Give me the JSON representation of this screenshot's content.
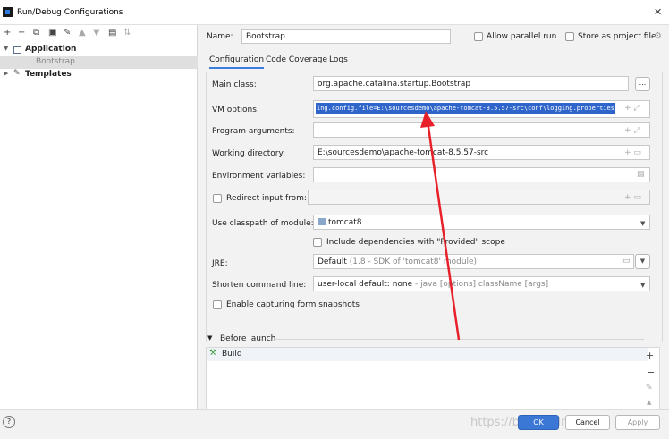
{
  "window": {
    "title": "Run/Debug Configurations",
    "close_glyph": "✕"
  },
  "tree": {
    "application": "Application",
    "bootstrap": "Bootstrap",
    "templates": "Templates"
  },
  "name": {
    "label": "Name:",
    "value": "Bootstrap",
    "allow_parallel_run": "Allow parallel run",
    "store_as_project_file": "Store as project file"
  },
  "tabs": [
    "Configuration",
    "Code Coverage",
    "Logs"
  ],
  "form": {
    "main_class": {
      "label": "Main class:",
      "value": "org.apache.catalina.startup.Bootstrap",
      "button": "..."
    },
    "vm_options": {
      "label": "VM options:",
      "value": "ing.config.file=E:\\sourcesdemo\\apache-tomcat-8.5.57-src\\conf\\logging.properties"
    },
    "program_arguments": {
      "label": "Program arguments:",
      "value": ""
    },
    "working_directory": {
      "label": "Working directory:",
      "value": "E:\\sourcesdemo\\apache-tomcat-8.5.57-src"
    },
    "environment_variables": {
      "label": "Environment variables:",
      "value": ""
    },
    "redirect_input": {
      "label": "Redirect input from:",
      "value": ""
    },
    "classpath_module": {
      "label": "Use classpath of module:",
      "value": "tomcat8"
    },
    "include_provided": "Include dependencies with \"Provided\" scope",
    "jre": {
      "label": "JRE:",
      "value": "Default",
      "hint": "(1.8 - SDK of 'tomcat8' module)"
    },
    "shorten_command_line": {
      "label": "Shorten command line:",
      "value": "user-local default: none",
      "hint": "- java [options] className [args]"
    },
    "capturing_snapshots": "Enable capturing form snapshots"
  },
  "before_launch": {
    "label": "Before launch",
    "items": [
      "Build"
    ]
  },
  "buttons": {
    "ok": "OK",
    "cancel": "Cancel",
    "apply": "Apply",
    "help": "?"
  },
  "watermark": "https://blog.csdn.net/...",
  "colors": {
    "accent": "#3b78d6",
    "selection": "#3d7de0",
    "annotation_arrow": "#e8202a"
  }
}
